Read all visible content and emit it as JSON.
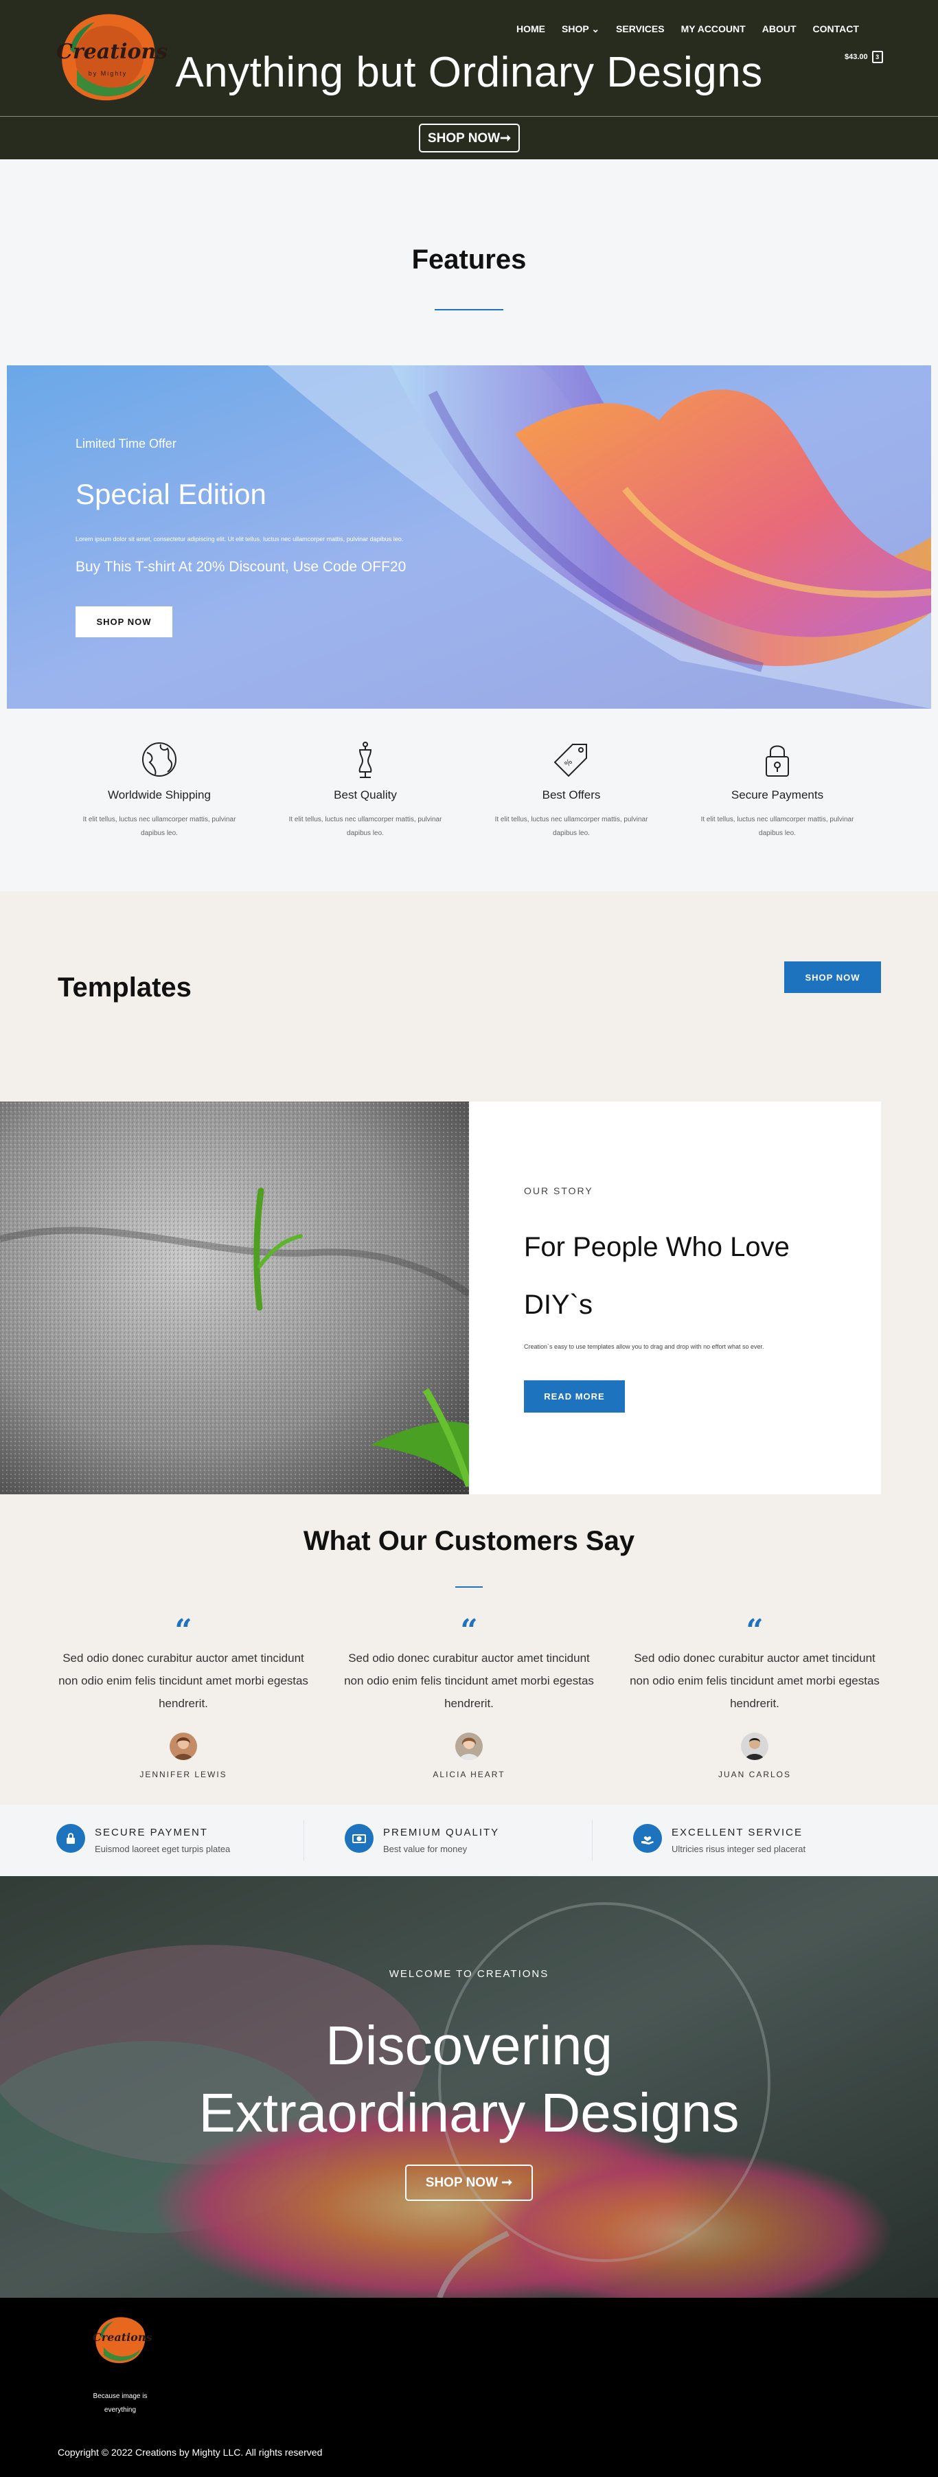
{
  "header": {
    "logo_text": "Creations",
    "logo_sub": "by Mighty",
    "nav": [
      {
        "label": "HOME"
      },
      {
        "label": "SHOP ⌄"
      },
      {
        "label": "SERVICES"
      },
      {
        "label": "MY ACCOUNT"
      },
      {
        "label": "ABOUT"
      },
      {
        "label": "CONTACT"
      }
    ],
    "cart_total": "$43.00",
    "cart_count": "3",
    "hero_title": "Anything but Ordinary Designs",
    "shop_now": "SHOP NOW➞"
  },
  "features": {
    "title": "Features",
    "banner": {
      "eyebrow": "Limited Time Offer",
      "title": "Special Edition",
      "small_text": "Lorem ipsum dolor sit amet, consectetur adipiscing elit. Ut elit tellus, luctus nec ullamcorper mattis, pulvinar dapibus leo.",
      "subtitle": "Buy This T-shirt At 20% Discount, Use Code OFF20",
      "button": "SHOP NOW"
    },
    "items": [
      {
        "icon": "globe-icon",
        "title": "Worldwide Shipping",
        "text": "It elit tellus, luctus nec ullamcorper mattis, pulvinar dapibus leo."
      },
      {
        "icon": "mannequin-icon",
        "title": "Best Quality",
        "text": "It elit tellus, luctus nec ullamcorper mattis, pulvinar dapibus leo."
      },
      {
        "icon": "price-tag-icon",
        "title": "Best Offers",
        "text": "It elit tellus, luctus nec ullamcorper mattis, pulvinar dapibus leo."
      },
      {
        "icon": "padlock-icon",
        "title": "Secure Payments",
        "text": "It elit tellus, luctus nec ullamcorper mattis, pulvinar dapibus leo."
      }
    ]
  },
  "templates": {
    "title": "Templates",
    "button": "SHOP NOW"
  },
  "story": {
    "eyebrow": "OUR STORY",
    "title": "For People Who Love DIY`s",
    "text": "Creation`s easy to use templates allow you to drag and drop with no effort what so ever.",
    "button": "READ MORE"
  },
  "testimonials": {
    "title": "What Our Customers Say",
    "items": [
      {
        "quote": "Sed odio donec curabitur auctor amet tincidunt non odio enim felis tincidunt amet morbi egestas hendrerit.",
        "name": "JENNIFER LEWIS"
      },
      {
        "quote": "Sed odio donec curabitur auctor amet tincidunt non odio enim felis tincidunt amet morbi egestas hendrerit.",
        "name": "ALICIA HEART"
      },
      {
        "quote": "Sed odio donec curabitur auctor amet tincidunt non odio enim felis tincidunt amet morbi egestas hendrerit.",
        "name": "JUAN CARLOS"
      }
    ]
  },
  "trust": [
    {
      "icon": "lock-icon",
      "title": "SECURE PAYMENT",
      "text": "Euismod laoreet eget turpis platea"
    },
    {
      "icon": "money-icon",
      "title": "PREMIUM QUALITY",
      "text": "Best value for money"
    },
    {
      "icon": "hand-heart-icon",
      "title": "EXCELLENT SERVICE",
      "text": "Ultricies risus integer sed placerat"
    }
  ],
  "welcome": {
    "eyebrow": "WELCOME TO CREATIONS",
    "title_line1": "Discovering",
    "title_line2": "Extraordinary Designs",
    "button": "SHOP NOW ➞"
  },
  "footer": {
    "tagline": "Because image is everything",
    "copyright": "Copyright © 2022 Creations by Mighty LLC. All rights reserved"
  },
  "colors": {
    "header_bg": "#272c1f",
    "accent": "#1e73be",
    "section_beige": "#f3f0eb",
    "footer_bg": "#000000"
  }
}
